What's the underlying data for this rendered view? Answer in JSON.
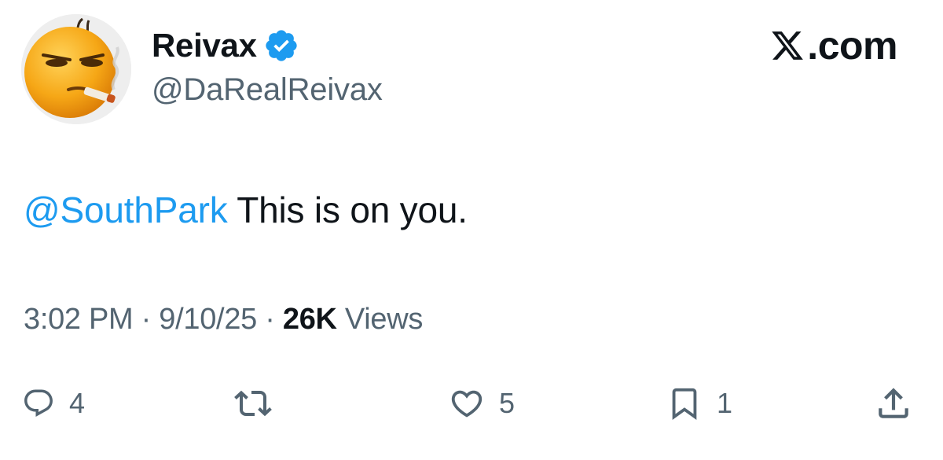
{
  "author": {
    "display_name": "Reivax",
    "handle": "@DaRealReivax",
    "verified": true,
    "avatar_icon": "smoking-emoji-face-icon"
  },
  "brand": {
    "text": ".com",
    "logo_icon": "x-logo-icon"
  },
  "tweet": {
    "mention": "@SouthPark",
    "text": " This is on you."
  },
  "meta": {
    "time": "3:02 PM",
    "separator1": " · ",
    "date": "9/10/25",
    "separator2": " · ",
    "views_count": "26K",
    "views_label": " Views"
  },
  "actions": {
    "reply_count": "4",
    "repost_count": "",
    "like_count": "5",
    "bookmark_count": "1"
  },
  "colors": {
    "accent": "#1d9bf0",
    "text_primary": "#0f1419",
    "text_secondary": "#536471"
  }
}
